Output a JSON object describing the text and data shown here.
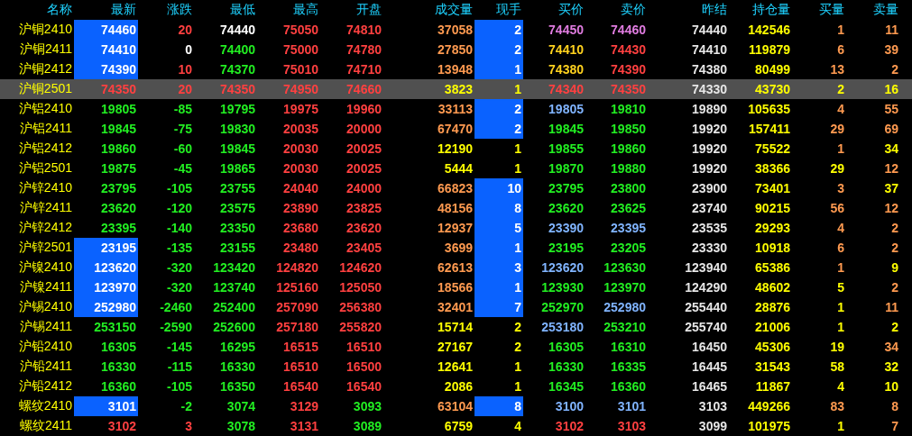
{
  "table": {
    "columns": [
      "名称",
      "最新",
      "涨跌",
      "最低",
      "最高",
      "开盘",
      "成交量",
      "现手",
      "买价",
      "卖价",
      "昨结",
      "持仓量",
      "买量",
      "卖量"
    ],
    "rows": [
      {
        "selected": false,
        "latest_highlighted": true,
        "current_highlighted": true,
        "cells": [
          {
            "text": "沪铜2410",
            "color": "#ffff00"
          },
          {
            "text": "74460",
            "color": "#ffffff"
          },
          {
            "text": "20",
            "color": "#ff4040"
          },
          {
            "text": "74440",
            "color": "#ffffff"
          },
          {
            "text": "75050",
            "color": "#ff4040"
          },
          {
            "text": "74810",
            "color": "#ff4040"
          },
          {
            "text": "37058",
            "color": "#ff9a50"
          },
          {
            "text": "2",
            "color": "#ffffff"
          },
          {
            "text": "74450",
            "color": "#e07ce0"
          },
          {
            "text": "74460",
            "color": "#e07ce0"
          },
          {
            "text": "74440",
            "color": "#e6e6e6"
          },
          {
            "text": "142546",
            "color": "#ffff00"
          },
          {
            "text": "1",
            "color": "#ff9a50"
          },
          {
            "text": "11",
            "color": "#ff9a50"
          }
        ]
      },
      {
        "selected": false,
        "latest_highlighted": true,
        "current_highlighted": true,
        "cells": [
          {
            "text": "沪铜2411",
            "color": "#ffff00"
          },
          {
            "text": "74410",
            "color": "#ffffff"
          },
          {
            "text": "0",
            "color": "#ffffff"
          },
          {
            "text": "74400",
            "color": "#22ee22"
          },
          {
            "text": "75000",
            "color": "#ff4040"
          },
          {
            "text": "74780",
            "color": "#ff4040"
          },
          {
            "text": "27850",
            "color": "#ff9a50"
          },
          {
            "text": "2",
            "color": "#ffffff"
          },
          {
            "text": "74410",
            "color": "#ffd21e"
          },
          {
            "text": "74430",
            "color": "#ff4040"
          },
          {
            "text": "74410",
            "color": "#e6e6e6"
          },
          {
            "text": "119879",
            "color": "#ffff00"
          },
          {
            "text": "6",
            "color": "#ff9a50"
          },
          {
            "text": "39",
            "color": "#ff9a50"
          }
        ]
      },
      {
        "selected": false,
        "latest_highlighted": true,
        "current_highlighted": true,
        "cells": [
          {
            "text": "沪铜2412",
            "color": "#ffff00"
          },
          {
            "text": "74390",
            "color": "#ffffff"
          },
          {
            "text": "10",
            "color": "#ff4040"
          },
          {
            "text": "74370",
            "color": "#22ee22"
          },
          {
            "text": "75010",
            "color": "#ff4040"
          },
          {
            "text": "74710",
            "color": "#ff4040"
          },
          {
            "text": "13948",
            "color": "#ff9a50"
          },
          {
            "text": "1",
            "color": "#ffffff"
          },
          {
            "text": "74380",
            "color": "#ffd21e"
          },
          {
            "text": "74390",
            "color": "#ff4040"
          },
          {
            "text": "74380",
            "color": "#e6e6e6"
          },
          {
            "text": "80499",
            "color": "#ffff00"
          },
          {
            "text": "13",
            "color": "#ff9a50"
          },
          {
            "text": "2",
            "color": "#ff9a50"
          }
        ]
      },
      {
        "selected": true,
        "latest_highlighted": false,
        "current_highlighted": false,
        "cells": [
          {
            "text": "沪铜2501",
            "color": "#ffff00"
          },
          {
            "text": "74350",
            "color": "#ff4040"
          },
          {
            "text": "20",
            "color": "#ff4040"
          },
          {
            "text": "74350",
            "color": "#ff4040"
          },
          {
            "text": "74950",
            "color": "#ff4040"
          },
          {
            "text": "74660",
            "color": "#ff4040"
          },
          {
            "text": "3823",
            "color": "#ffff00"
          },
          {
            "text": "1",
            "color": "#ffff00"
          },
          {
            "text": "74340",
            "color": "#ff4040"
          },
          {
            "text": "74350",
            "color": "#ff4040"
          },
          {
            "text": "74330",
            "color": "#e6e6e6"
          },
          {
            "text": "43730",
            "color": "#ffff00"
          },
          {
            "text": "2",
            "color": "#ffff00"
          },
          {
            "text": "16",
            "color": "#ffff00"
          }
        ]
      },
      {
        "selected": false,
        "latest_highlighted": false,
        "current_highlighted": true,
        "cells": [
          {
            "text": "沪铝2410",
            "color": "#ffff00"
          },
          {
            "text": "19805",
            "color": "#22ee22"
          },
          {
            "text": "-85",
            "color": "#22ee22"
          },
          {
            "text": "19795",
            "color": "#22ee22"
          },
          {
            "text": "19975",
            "color": "#ff4040"
          },
          {
            "text": "19960",
            "color": "#ff4040"
          },
          {
            "text": "33113",
            "color": "#ff9a50"
          },
          {
            "text": "2",
            "color": "#ffffff"
          },
          {
            "text": "19805",
            "color": "#80b4ff"
          },
          {
            "text": "19810",
            "color": "#22ee22"
          },
          {
            "text": "19890",
            "color": "#e6e6e6"
          },
          {
            "text": "105635",
            "color": "#ffff00"
          },
          {
            "text": "4",
            "color": "#ff9a50"
          },
          {
            "text": "55",
            "color": "#ff9a50"
          }
        ]
      },
      {
        "selected": false,
        "latest_highlighted": false,
        "current_highlighted": true,
        "cells": [
          {
            "text": "沪铝2411",
            "color": "#ffff00"
          },
          {
            "text": "19845",
            "color": "#22ee22"
          },
          {
            "text": "-75",
            "color": "#22ee22"
          },
          {
            "text": "19830",
            "color": "#22ee22"
          },
          {
            "text": "20035",
            "color": "#ff4040"
          },
          {
            "text": "20000",
            "color": "#ff4040"
          },
          {
            "text": "67470",
            "color": "#ff9a50"
          },
          {
            "text": "2",
            "color": "#ffffff"
          },
          {
            "text": "19845",
            "color": "#22ee22"
          },
          {
            "text": "19850",
            "color": "#22ee22"
          },
          {
            "text": "19920",
            "color": "#e6e6e6"
          },
          {
            "text": "157411",
            "color": "#ffff00"
          },
          {
            "text": "29",
            "color": "#ff9a50"
          },
          {
            "text": "69",
            "color": "#ff9a50"
          }
        ]
      },
      {
        "selected": false,
        "latest_highlighted": false,
        "current_highlighted": false,
        "cells": [
          {
            "text": "沪铝2412",
            "color": "#ffff00"
          },
          {
            "text": "19860",
            "color": "#22ee22"
          },
          {
            "text": "-60",
            "color": "#22ee22"
          },
          {
            "text": "19845",
            "color": "#22ee22"
          },
          {
            "text": "20030",
            "color": "#ff4040"
          },
          {
            "text": "20025",
            "color": "#ff4040"
          },
          {
            "text": "12190",
            "color": "#ffff00"
          },
          {
            "text": "1",
            "color": "#ffff00"
          },
          {
            "text": "19855",
            "color": "#22ee22"
          },
          {
            "text": "19860",
            "color": "#22ee22"
          },
          {
            "text": "19920",
            "color": "#e6e6e6"
          },
          {
            "text": "75522",
            "color": "#ffff00"
          },
          {
            "text": "1",
            "color": "#ff9a50"
          },
          {
            "text": "34",
            "color": "#ffff00"
          }
        ]
      },
      {
        "selected": false,
        "latest_highlighted": false,
        "current_highlighted": false,
        "cells": [
          {
            "text": "沪铝2501",
            "color": "#ffff00"
          },
          {
            "text": "19875",
            "color": "#22ee22"
          },
          {
            "text": "-45",
            "color": "#22ee22"
          },
          {
            "text": "19865",
            "color": "#22ee22"
          },
          {
            "text": "20030",
            "color": "#ff4040"
          },
          {
            "text": "20025",
            "color": "#ff4040"
          },
          {
            "text": "5444",
            "color": "#ffff00"
          },
          {
            "text": "1",
            "color": "#ffff00"
          },
          {
            "text": "19870",
            "color": "#22ee22"
          },
          {
            "text": "19880",
            "color": "#22ee22"
          },
          {
            "text": "19920",
            "color": "#e6e6e6"
          },
          {
            "text": "38366",
            "color": "#ffff00"
          },
          {
            "text": "29",
            "color": "#ffff00"
          },
          {
            "text": "12",
            "color": "#ff9a50"
          }
        ]
      },
      {
        "selected": false,
        "latest_highlighted": false,
        "current_highlighted": true,
        "cells": [
          {
            "text": "沪锌2410",
            "color": "#ffff00"
          },
          {
            "text": "23795",
            "color": "#22ee22"
          },
          {
            "text": "-105",
            "color": "#22ee22"
          },
          {
            "text": "23755",
            "color": "#22ee22"
          },
          {
            "text": "24040",
            "color": "#ff4040"
          },
          {
            "text": "24000",
            "color": "#ff4040"
          },
          {
            "text": "66823",
            "color": "#ff9a50"
          },
          {
            "text": "10",
            "color": "#ffffff"
          },
          {
            "text": "23795",
            "color": "#22ee22"
          },
          {
            "text": "23800",
            "color": "#22ee22"
          },
          {
            "text": "23900",
            "color": "#e6e6e6"
          },
          {
            "text": "73401",
            "color": "#ffff00"
          },
          {
            "text": "3",
            "color": "#ff9a50"
          },
          {
            "text": "37",
            "color": "#ffff00"
          }
        ]
      },
      {
        "selected": false,
        "latest_highlighted": false,
        "current_highlighted": true,
        "cells": [
          {
            "text": "沪锌2411",
            "color": "#ffff00"
          },
          {
            "text": "23620",
            "color": "#22ee22"
          },
          {
            "text": "-120",
            "color": "#22ee22"
          },
          {
            "text": "23575",
            "color": "#22ee22"
          },
          {
            "text": "23890",
            "color": "#ff4040"
          },
          {
            "text": "23825",
            "color": "#ff4040"
          },
          {
            "text": "48156",
            "color": "#ff9a50"
          },
          {
            "text": "8",
            "color": "#ffffff"
          },
          {
            "text": "23620",
            "color": "#22ee22"
          },
          {
            "text": "23625",
            "color": "#22ee22"
          },
          {
            "text": "23740",
            "color": "#e6e6e6"
          },
          {
            "text": "90215",
            "color": "#ffff00"
          },
          {
            "text": "56",
            "color": "#ff9a50"
          },
          {
            "text": "12",
            "color": "#ff9a50"
          }
        ]
      },
      {
        "selected": false,
        "latest_highlighted": false,
        "current_highlighted": true,
        "cells": [
          {
            "text": "沪锌2412",
            "color": "#ffff00"
          },
          {
            "text": "23395",
            "color": "#22ee22"
          },
          {
            "text": "-140",
            "color": "#22ee22"
          },
          {
            "text": "23350",
            "color": "#22ee22"
          },
          {
            "text": "23680",
            "color": "#ff4040"
          },
          {
            "text": "23620",
            "color": "#ff4040"
          },
          {
            "text": "12937",
            "color": "#ff9a50"
          },
          {
            "text": "5",
            "color": "#ffffff"
          },
          {
            "text": "23390",
            "color": "#80b4ff"
          },
          {
            "text": "23395",
            "color": "#80b4ff"
          },
          {
            "text": "23535",
            "color": "#e6e6e6"
          },
          {
            "text": "29293",
            "color": "#ffff00"
          },
          {
            "text": "4",
            "color": "#ff9a50"
          },
          {
            "text": "2",
            "color": "#ff9a50"
          }
        ]
      },
      {
        "selected": false,
        "latest_highlighted": true,
        "current_highlighted": true,
        "cells": [
          {
            "text": "沪锌2501",
            "color": "#ffff00"
          },
          {
            "text": "23195",
            "color": "#ffffff"
          },
          {
            "text": "-135",
            "color": "#22ee22"
          },
          {
            "text": "23155",
            "color": "#22ee22"
          },
          {
            "text": "23480",
            "color": "#ff4040"
          },
          {
            "text": "23405",
            "color": "#ff4040"
          },
          {
            "text": "3699",
            "color": "#ff9a50"
          },
          {
            "text": "1",
            "color": "#ffffff"
          },
          {
            "text": "23195",
            "color": "#22ee22"
          },
          {
            "text": "23205",
            "color": "#22ee22"
          },
          {
            "text": "23330",
            "color": "#e6e6e6"
          },
          {
            "text": "10918",
            "color": "#ffff00"
          },
          {
            "text": "6",
            "color": "#ff9a50"
          },
          {
            "text": "2",
            "color": "#ff9a50"
          }
        ]
      },
      {
        "selected": false,
        "latest_highlighted": true,
        "current_highlighted": true,
        "cells": [
          {
            "text": "沪镍2410",
            "color": "#ffff00"
          },
          {
            "text": "123620",
            "color": "#ffffff"
          },
          {
            "text": "-320",
            "color": "#22ee22"
          },
          {
            "text": "123420",
            "color": "#22ee22"
          },
          {
            "text": "124820",
            "color": "#ff4040"
          },
          {
            "text": "124620",
            "color": "#ff4040"
          },
          {
            "text": "62613",
            "color": "#ff9a50"
          },
          {
            "text": "3",
            "color": "#ffffff"
          },
          {
            "text": "123620",
            "color": "#80b4ff"
          },
          {
            "text": "123630",
            "color": "#22ee22"
          },
          {
            "text": "123940",
            "color": "#e6e6e6"
          },
          {
            "text": "65386",
            "color": "#ffff00"
          },
          {
            "text": "1",
            "color": "#ff9a50"
          },
          {
            "text": "9",
            "color": "#ffff00"
          }
        ]
      },
      {
        "selected": false,
        "latest_highlighted": true,
        "current_highlighted": true,
        "cells": [
          {
            "text": "沪镍2411",
            "color": "#ffff00"
          },
          {
            "text": "123970",
            "color": "#ffffff"
          },
          {
            "text": "-320",
            "color": "#22ee22"
          },
          {
            "text": "123740",
            "color": "#22ee22"
          },
          {
            "text": "125160",
            "color": "#ff4040"
          },
          {
            "text": "125050",
            "color": "#ff4040"
          },
          {
            "text": "18566",
            "color": "#ff9a50"
          },
          {
            "text": "1",
            "color": "#ffffff"
          },
          {
            "text": "123930",
            "color": "#22ee22"
          },
          {
            "text": "123970",
            "color": "#22ee22"
          },
          {
            "text": "124290",
            "color": "#e6e6e6"
          },
          {
            "text": "48602",
            "color": "#ffff00"
          },
          {
            "text": "5",
            "color": "#ffff00"
          },
          {
            "text": "2",
            "color": "#ff9a50"
          }
        ]
      },
      {
        "selected": false,
        "latest_highlighted": true,
        "current_highlighted": true,
        "cells": [
          {
            "text": "沪锡2410",
            "color": "#ffff00"
          },
          {
            "text": "252980",
            "color": "#ffffff"
          },
          {
            "text": "-2460",
            "color": "#22ee22"
          },
          {
            "text": "252400",
            "color": "#22ee22"
          },
          {
            "text": "257090",
            "color": "#ff4040"
          },
          {
            "text": "256380",
            "color": "#ff4040"
          },
          {
            "text": "32401",
            "color": "#ff9a50"
          },
          {
            "text": "7",
            "color": "#ffffff"
          },
          {
            "text": "252970",
            "color": "#22ee22"
          },
          {
            "text": "252980",
            "color": "#80b4ff"
          },
          {
            "text": "255440",
            "color": "#e6e6e6"
          },
          {
            "text": "28876",
            "color": "#ffff00"
          },
          {
            "text": "1",
            "color": "#ffff00"
          },
          {
            "text": "11",
            "color": "#ff9a50"
          }
        ]
      },
      {
        "selected": false,
        "latest_highlighted": false,
        "current_highlighted": false,
        "cells": [
          {
            "text": "沪锡2411",
            "color": "#ffff00"
          },
          {
            "text": "253150",
            "color": "#22ee22"
          },
          {
            "text": "-2590",
            "color": "#22ee22"
          },
          {
            "text": "252600",
            "color": "#22ee22"
          },
          {
            "text": "257180",
            "color": "#ff4040"
          },
          {
            "text": "255820",
            "color": "#ff4040"
          },
          {
            "text": "15714",
            "color": "#ffff00"
          },
          {
            "text": "2",
            "color": "#ffff00"
          },
          {
            "text": "253180",
            "color": "#80b4ff"
          },
          {
            "text": "253210",
            "color": "#22ee22"
          },
          {
            "text": "255740",
            "color": "#e6e6e6"
          },
          {
            "text": "21006",
            "color": "#ffff00"
          },
          {
            "text": "1",
            "color": "#ffff00"
          },
          {
            "text": "2",
            "color": "#ffff00"
          }
        ]
      },
      {
        "selected": false,
        "latest_highlighted": false,
        "current_highlighted": false,
        "cells": [
          {
            "text": "沪铅2410",
            "color": "#ffff00"
          },
          {
            "text": "16305",
            "color": "#22ee22"
          },
          {
            "text": "-145",
            "color": "#22ee22"
          },
          {
            "text": "16295",
            "color": "#22ee22"
          },
          {
            "text": "16515",
            "color": "#ff4040"
          },
          {
            "text": "16510",
            "color": "#ff4040"
          },
          {
            "text": "27167",
            "color": "#ffff00"
          },
          {
            "text": "2",
            "color": "#ffff00"
          },
          {
            "text": "16305",
            "color": "#22ee22"
          },
          {
            "text": "16310",
            "color": "#22ee22"
          },
          {
            "text": "16450",
            "color": "#e6e6e6"
          },
          {
            "text": "45306",
            "color": "#ffff00"
          },
          {
            "text": "19",
            "color": "#ffff00"
          },
          {
            "text": "34",
            "color": "#ff9a50"
          }
        ]
      },
      {
        "selected": false,
        "latest_highlighted": false,
        "current_highlighted": false,
        "cells": [
          {
            "text": "沪铅2411",
            "color": "#ffff00"
          },
          {
            "text": "16330",
            "color": "#22ee22"
          },
          {
            "text": "-115",
            "color": "#22ee22"
          },
          {
            "text": "16330",
            "color": "#22ee22"
          },
          {
            "text": "16510",
            "color": "#ff4040"
          },
          {
            "text": "16500",
            "color": "#ff4040"
          },
          {
            "text": "12641",
            "color": "#ffff00"
          },
          {
            "text": "1",
            "color": "#ffff00"
          },
          {
            "text": "16330",
            "color": "#22ee22"
          },
          {
            "text": "16335",
            "color": "#22ee22"
          },
          {
            "text": "16445",
            "color": "#e6e6e6"
          },
          {
            "text": "31543",
            "color": "#ffff00"
          },
          {
            "text": "58",
            "color": "#ffff00"
          },
          {
            "text": "32",
            "color": "#ffff00"
          }
        ]
      },
      {
        "selected": false,
        "latest_highlighted": false,
        "current_highlighted": false,
        "cells": [
          {
            "text": "沪铅2412",
            "color": "#ffff00"
          },
          {
            "text": "16360",
            "color": "#22ee22"
          },
          {
            "text": "-105",
            "color": "#22ee22"
          },
          {
            "text": "16350",
            "color": "#22ee22"
          },
          {
            "text": "16540",
            "color": "#ff4040"
          },
          {
            "text": "16540",
            "color": "#ff4040"
          },
          {
            "text": "2086",
            "color": "#ffff00"
          },
          {
            "text": "1",
            "color": "#ffff00"
          },
          {
            "text": "16345",
            "color": "#22ee22"
          },
          {
            "text": "16360",
            "color": "#22ee22"
          },
          {
            "text": "16465",
            "color": "#e6e6e6"
          },
          {
            "text": "11867",
            "color": "#ffff00"
          },
          {
            "text": "4",
            "color": "#ffff00"
          },
          {
            "text": "10",
            "color": "#ffff00"
          }
        ]
      },
      {
        "selected": false,
        "latest_highlighted": true,
        "current_highlighted": true,
        "cells": [
          {
            "text": "螺纹2410",
            "color": "#ffff00"
          },
          {
            "text": "3101",
            "color": "#ffffff"
          },
          {
            "text": "-2",
            "color": "#22ee22"
          },
          {
            "text": "3074",
            "color": "#22ee22"
          },
          {
            "text": "3129",
            "color": "#ff4040"
          },
          {
            "text": "3093",
            "color": "#22ee22"
          },
          {
            "text": "63104",
            "color": "#ff9a50"
          },
          {
            "text": "8",
            "color": "#ffffff"
          },
          {
            "text": "3100",
            "color": "#80b4ff"
          },
          {
            "text": "3101",
            "color": "#80b4ff"
          },
          {
            "text": "3103",
            "color": "#e6e6e6"
          },
          {
            "text": "449266",
            "color": "#ffff00"
          },
          {
            "text": "83",
            "color": "#ff9a50"
          },
          {
            "text": "8",
            "color": "#ff9a50"
          }
        ]
      },
      {
        "selected": false,
        "latest_highlighted": false,
        "current_highlighted": false,
        "cells": [
          {
            "text": "螺纹2411",
            "color": "#ffff00"
          },
          {
            "text": "3102",
            "color": "#ff4040"
          },
          {
            "text": "3",
            "color": "#ff4040"
          },
          {
            "text": "3078",
            "color": "#22ee22"
          },
          {
            "text": "3131",
            "color": "#ff4040"
          },
          {
            "text": "3089",
            "color": "#22ee22"
          },
          {
            "text": "6759",
            "color": "#ffff00"
          },
          {
            "text": "4",
            "color": "#ffff00"
          },
          {
            "text": "3102",
            "color": "#ff4040"
          },
          {
            "text": "3103",
            "color": "#ff4040"
          },
          {
            "text": "3099",
            "color": "#e6e6e6"
          },
          {
            "text": "101975",
            "color": "#ffff00"
          },
          {
            "text": "1",
            "color": "#ffff00"
          },
          {
            "text": "7",
            "color": "#ff9a50"
          }
        ]
      }
    ]
  }
}
